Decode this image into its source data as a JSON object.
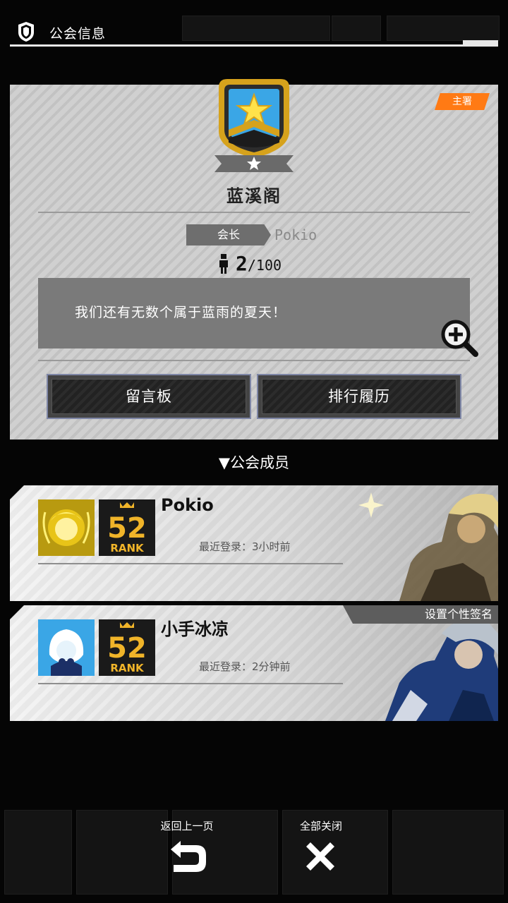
{
  "header": {
    "title": "公会信息"
  },
  "guild": {
    "badge": "主署",
    "name": "蓝溪阁",
    "leader_label": "会长",
    "leader_name": "Pokio",
    "member_count": "2",
    "member_capacity": "/100",
    "motto": "我们还有无数个属于蓝雨的夏天！"
  },
  "buttons": {
    "message_board": "留言板",
    "ranking_history": "排行履历"
  },
  "members_section": {
    "title": "▼公会成员"
  },
  "members": [
    {
      "name": "Pokio",
      "last_login": "最近登录：3小时前",
      "rank": "52",
      "rank_label": "RANK"
    },
    {
      "name": "小手冰凉",
      "last_login": "最近登录：2分钟前",
      "rank": "52",
      "rank_label": "RANK",
      "signature_tag": "设置个性签名"
    }
  ],
  "bottom": {
    "back_label": "返回上一页",
    "close_all_label": "全部关闭"
  },
  "colors": {
    "accent_orange": "#ff7a14",
    "emblem_blue": "#3aa6e6",
    "emblem_gold": "#d6a21c",
    "rank_gold": "#f0b429"
  }
}
